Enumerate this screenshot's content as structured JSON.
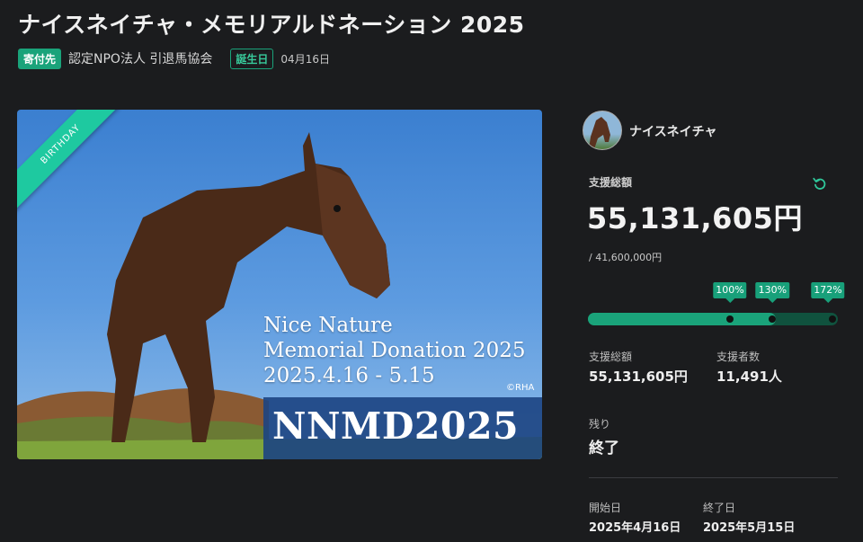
{
  "title": "ナイスネイチャ・メモリアルドネーション 2025",
  "meta": {
    "donee_badge": "寄付先",
    "organization": "認定NPO法人 引退馬協会",
    "birthday_badge": "誕生日",
    "birthday_date": "04月16日"
  },
  "hero": {
    "ribbon": "BIRTHDAY",
    "line1": "Nice Nature",
    "line2": "Memorial Donation 2025",
    "line3": "2025.4.16 - 5.15",
    "copyright": "©RHA",
    "big": "NNMD2025"
  },
  "sidebar": {
    "horse_name": "ナイスネイチャ",
    "total_label": "支援総額",
    "total_amount": "55,131,605円",
    "goal": "/ 41,600,000円",
    "milestones": [
      {
        "label": "100%",
        "value": 100
      },
      {
        "label": "130%",
        "value": 130
      },
      {
        "label": "172%",
        "value": 172
      }
    ],
    "progress_percent": 132.5,
    "progress_scale_max": 176,
    "stats": {
      "amount_label": "支援総額",
      "amount_value": "55,131,605円",
      "supporters_label": "支援者数",
      "supporters_value": "11,491人"
    },
    "remaining_label": "残り",
    "remaining_value": "終了",
    "start_label": "開始日",
    "start_value": "2025年4月16日",
    "end_label": "終了日",
    "end_value": "2025年5月15日"
  },
  "colors": {
    "accent": "#1aa37a",
    "bar_fill": "#1aa37a",
    "bar_track": "#10523e",
    "background": "#1b1c1e"
  },
  "icons": {
    "refresh": "refresh-icon"
  }
}
